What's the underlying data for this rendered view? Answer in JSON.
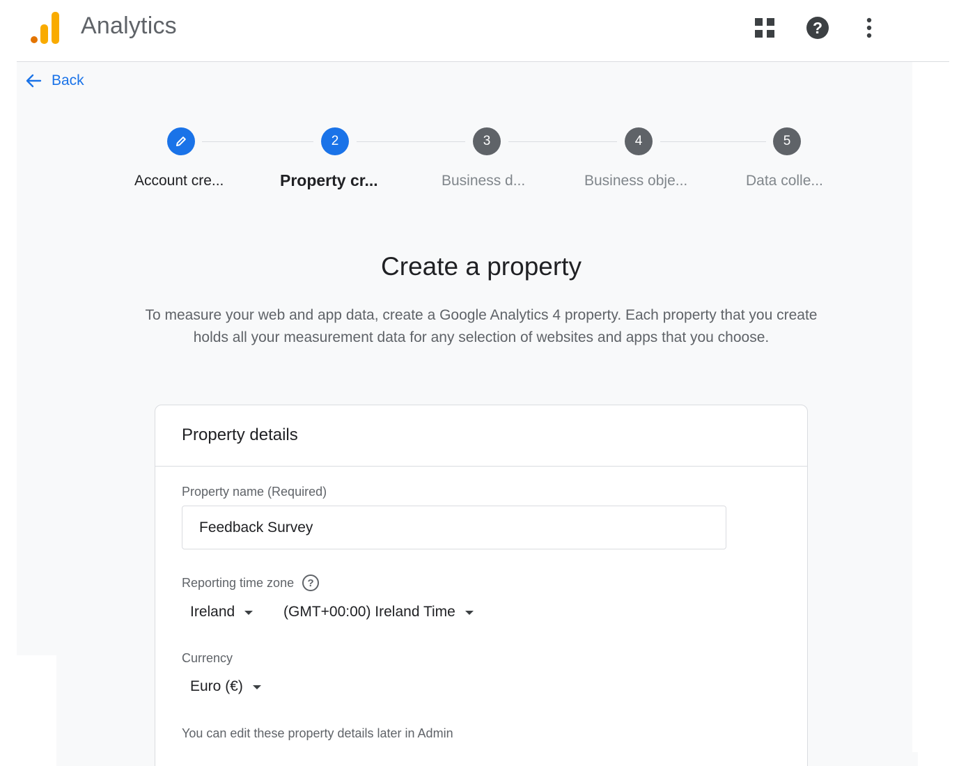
{
  "app": {
    "title": "Analytics",
    "logo_colors": [
      "#e37400",
      "#f9ab00",
      "#f9ab00"
    ]
  },
  "topbar": {
    "apps_icon": "apps-grid-icon",
    "help_icon": "help-icon",
    "more_icon": "more-vert-icon"
  },
  "nav": {
    "back_label": "Back"
  },
  "stepper": {
    "steps": [
      {
        "number": "",
        "label": "Account cre...",
        "state": "done"
      },
      {
        "number": "2",
        "label": "Property cr...",
        "state": "active"
      },
      {
        "number": "3",
        "label": "Business d...",
        "state": "todo"
      },
      {
        "number": "4",
        "label": "Business obje...",
        "state": "todo"
      },
      {
        "number": "5",
        "label": "Data colle...",
        "state": "todo"
      }
    ]
  },
  "main": {
    "title": "Create a property",
    "description": "To measure your web and app data, create a Google Analytics 4 property. Each property that you create holds all your measurement data for any selection of websites and apps that you choose."
  },
  "card": {
    "title": "Property details",
    "property_name_label": "Property name (Required)",
    "property_name_value": "Feedback Survey",
    "timezone_label": "Reporting time zone",
    "timezone_country": "Ireland",
    "timezone_value": "(GMT+00:00) Ireland Time",
    "currency_label": "Currency",
    "currency_value": "Euro (€)",
    "footnote": "You can edit these property details later in Admin"
  },
  "colors": {
    "accent": "#1a73e8",
    "step_inactive": "#5f6368",
    "canvas_bg": "#f8f9fa"
  }
}
